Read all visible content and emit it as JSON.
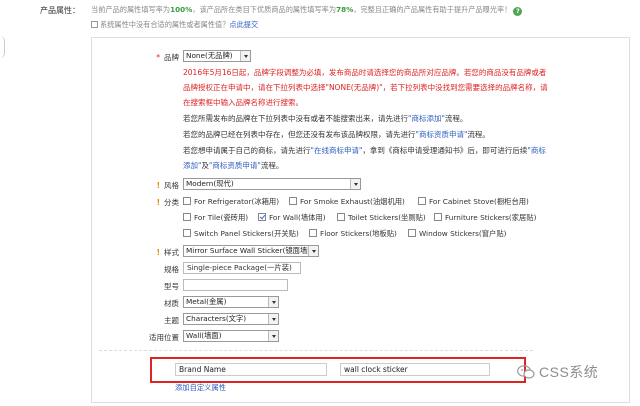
{
  "header": {
    "label": "产品属性：",
    "notice_pre": "当前产品的属性填写率为",
    "rate1": "100%",
    "notice_mid": "，该产品所在类目下优质商品的属性填写率为",
    "rate2": "78%",
    "notice_post": "，完整且正确的产品属性有助于提升产品曝光率！",
    "help_icon": "?",
    "notice2": "系统属性中没有合适的属性或者属性值？",
    "notice2_link": "点此提交"
  },
  "brand": {
    "label": "品牌",
    "value": "None(无品牌)",
    "warn1": "2016年5月16日起，品牌字段调整为必填，发布商品时请选择您的商品所对应品牌。若您的商品没有品牌或者",
    "warn2": "品牌授权正在申请中，请在下拉列表中选择\"NONE(无品牌)\"，若下拉列表中没找到您需要选择的品牌名称，请",
    "warn3": "在搜索框中输入品牌名称进行搜索。",
    "info1_pre": "若您所需发布的品牌在下拉列表中没有或者不能搜索出来，请先进行",
    "info1_link": "\"商标添加\"",
    "info1_post": "流程。",
    "info2_pre": "若您的品牌已经在列表中存在，但您还没有发布该品牌权限，请先进行",
    "info2_link": "\"商标资质申请\"",
    "info2_post": "流程。",
    "info3_pre": "若您想申请属于自己的商标，请先进行",
    "info3_link1": "\"在线商标申请\"",
    "info3_mid": "，拿到《商标申请受理通知书》后，即可进行后续",
    "info3_link2": "\"商标",
    "info4_link": "添加\"",
    "info4_mid": "及",
    "info4_link2": "\"商标资质申请\"",
    "info4_post": "流程。"
  },
  "style": {
    "label": "风格",
    "value": "Modern(现代)"
  },
  "category": {
    "label": "分类",
    "options": [
      {
        "label": "For Refrigerator(冰箱用)",
        "checked": false
      },
      {
        "label": "For Smoke Exhaust(油烟机用)",
        "checked": false
      },
      {
        "label": "For Cabinet Stove(橱柜台用)",
        "checked": false
      },
      {
        "label": "For Tile(瓷砖用)",
        "checked": false
      },
      {
        "label": "For Wall(墙体用)",
        "checked": true
      },
      {
        "label": "Toilet Stickers(坐厕贴)",
        "checked": false
      },
      {
        "label": "Furniture Stickers(家居贴)",
        "checked": false
      },
      {
        "label": "Switch Panel Stickers(开关贴)",
        "checked": false
      },
      {
        "label": "Floor Stickers(地板贴)",
        "checked": false
      },
      {
        "label": "Window Stickers(窗户贴)",
        "checked": false
      }
    ]
  },
  "pattern": {
    "label": "样式",
    "value": "Mirror Surface Wall Sticker(镜面墙贴)"
  },
  "spec": {
    "label": "规格",
    "value": "Single-piece Package(一片装)"
  },
  "model": {
    "label": "型号",
    "value": ""
  },
  "material": {
    "label": "材质",
    "value": "Metal(金属)"
  },
  "theme": {
    "label": "主题",
    "value": "Characters(文字)"
  },
  "location": {
    "label": "适用位置",
    "value": "Wall(墙面)"
  },
  "custom": {
    "name_value": "Brand Name",
    "value_value": "wall clock sticker",
    "delete_icon": "×",
    "add_link": "添加自定义属性"
  },
  "watermark": {
    "text": "CSS系统"
  },
  "colors": {
    "required": "#d22222",
    "link": "#2e5dbf",
    "highlight": "#e02424",
    "rate": "#3a9b3a"
  }
}
